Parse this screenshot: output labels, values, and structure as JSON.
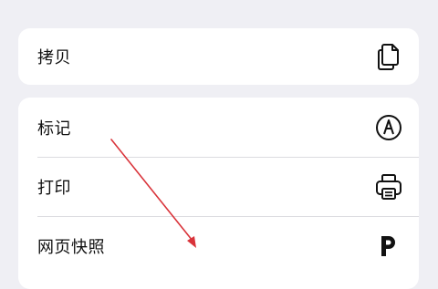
{
  "menu": {
    "copy": {
      "label": "拷贝",
      "icon": "copy-icon"
    },
    "markup": {
      "label": "标记",
      "icon": "markup-pen-icon"
    },
    "print": {
      "label": "打印",
      "icon": "printer-icon"
    },
    "web_snapshot": {
      "label": "网页快照",
      "icon": "p-logo-icon"
    }
  },
  "annotation": {
    "arrow_color": "#d9333a"
  }
}
